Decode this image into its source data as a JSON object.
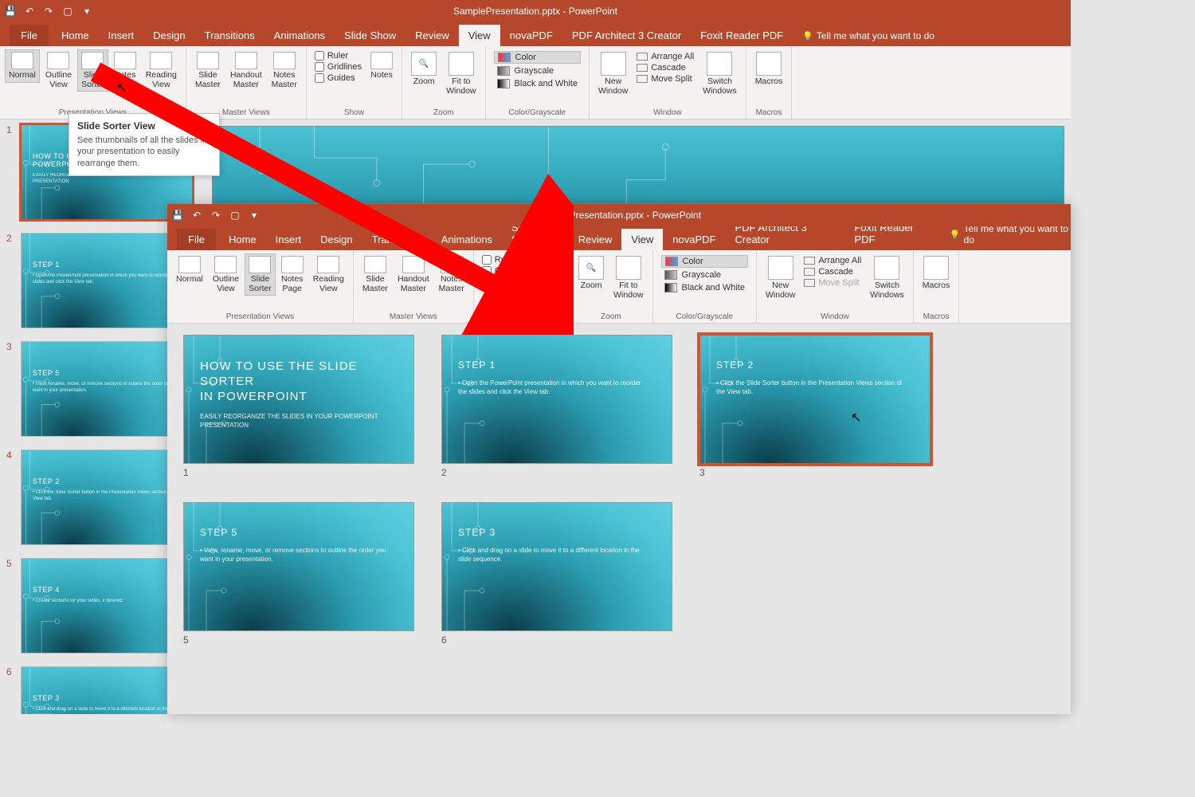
{
  "app_title": "SamplePresentation.pptx - PowerPoint",
  "menu": {
    "file": "File",
    "tabs": [
      "Home",
      "Insert",
      "Design",
      "Transitions",
      "Animations",
      "Slide Show",
      "Review",
      "View",
      "novaPDF",
      "PDF Architect 3 Creator",
      "Foxit Reader PDF"
    ],
    "active": "View",
    "tell": "Tell me what you want to do"
  },
  "ribbon": {
    "groups": {
      "presentation_views": {
        "label": "Presentation Views",
        "buttons": {
          "normal": "Normal",
          "outline": "Outline\nView",
          "sorter": "Slide\nSorter",
          "notes_page": "Notes\nPage",
          "reading": "Reading\nView"
        }
      },
      "master_views": {
        "label": "Master Views",
        "buttons": {
          "slide": "Slide\nMaster",
          "handout": "Handout\nMaster",
          "notes": "Notes\nMaster"
        }
      },
      "show": {
        "label": "Show",
        "ruler": "Ruler",
        "gridlines": "Gridlines",
        "guides": "Guides",
        "notes": "Notes"
      },
      "zoom": {
        "label": "Zoom",
        "zoom": "Zoom",
        "fit": "Fit to\nWindow"
      },
      "color": {
        "label": "Color/Grayscale",
        "color": "Color",
        "grayscale": "Grayscale",
        "bw": "Black and White"
      },
      "window": {
        "label": "Window",
        "new": "New\nWindow",
        "arrange": "Arrange All",
        "cascade": "Cascade",
        "split": "Move Split",
        "switch": "Switch\nWindows"
      },
      "macros": {
        "label": "Macros",
        "macros": "Macros"
      }
    }
  },
  "tooltip": {
    "title": "Slide Sorter View",
    "body": "See thumbnails of all the slides in your presentation to easily rearrange them."
  },
  "back_slides": [
    {
      "n": "1",
      "title": "HOW TO USE THE SLIDE SORTER\nIN POWERPOINT",
      "body": "EASILY REORGANIZE THE SLIDES IN YOUR POWERPOINT PRESENTATION",
      "sel": true
    },
    {
      "n": "2",
      "title": "STEP 1",
      "body": "• Open the PowerPoint presentation in which you want to reorder the slides and click the View tab."
    },
    {
      "n": "3",
      "title": "STEP 5",
      "body": "• View, rename, move, or remove sections to outline the order you want in your presentation."
    },
    {
      "n": "4",
      "title": "STEP 2",
      "body": "• Click the Slide Sorter button in the Presentation Views section of the View tab."
    },
    {
      "n": "5",
      "title": "STEP 4",
      "body": "• Create sections for your slides, if desired."
    },
    {
      "n": "6",
      "title": "STEP 3",
      "body": "• Click and drag on a slide to move it to a different location in the slide sequence."
    }
  ],
  "sorter_slides": [
    {
      "n": "1",
      "big": "HOW TO USE THE SLIDE SORTER\nIN POWERPOINT",
      "body": "EASILY REORGANIZE THE SLIDES IN YOUR POWERPOINT PRESENTATION"
    },
    {
      "n": "2",
      "title": "STEP 1",
      "body": "• Open the PowerPoint presentation in which you want to reorder the slides and click the View tab."
    },
    {
      "n": "3",
      "title": "STEP 2",
      "body": "• Click the Slide Sorter button in the Presentation Views section of the View tab.",
      "sel": true
    },
    {
      "n": "5",
      "title": "STEP 5",
      "body": "• View, rename, move, or remove sections to outline the order you want in your presentation."
    },
    {
      "n": "6",
      "title": "STEP 3",
      "body": "• Click and drag on a slide to move it to a different location in the slide sequence."
    }
  ]
}
